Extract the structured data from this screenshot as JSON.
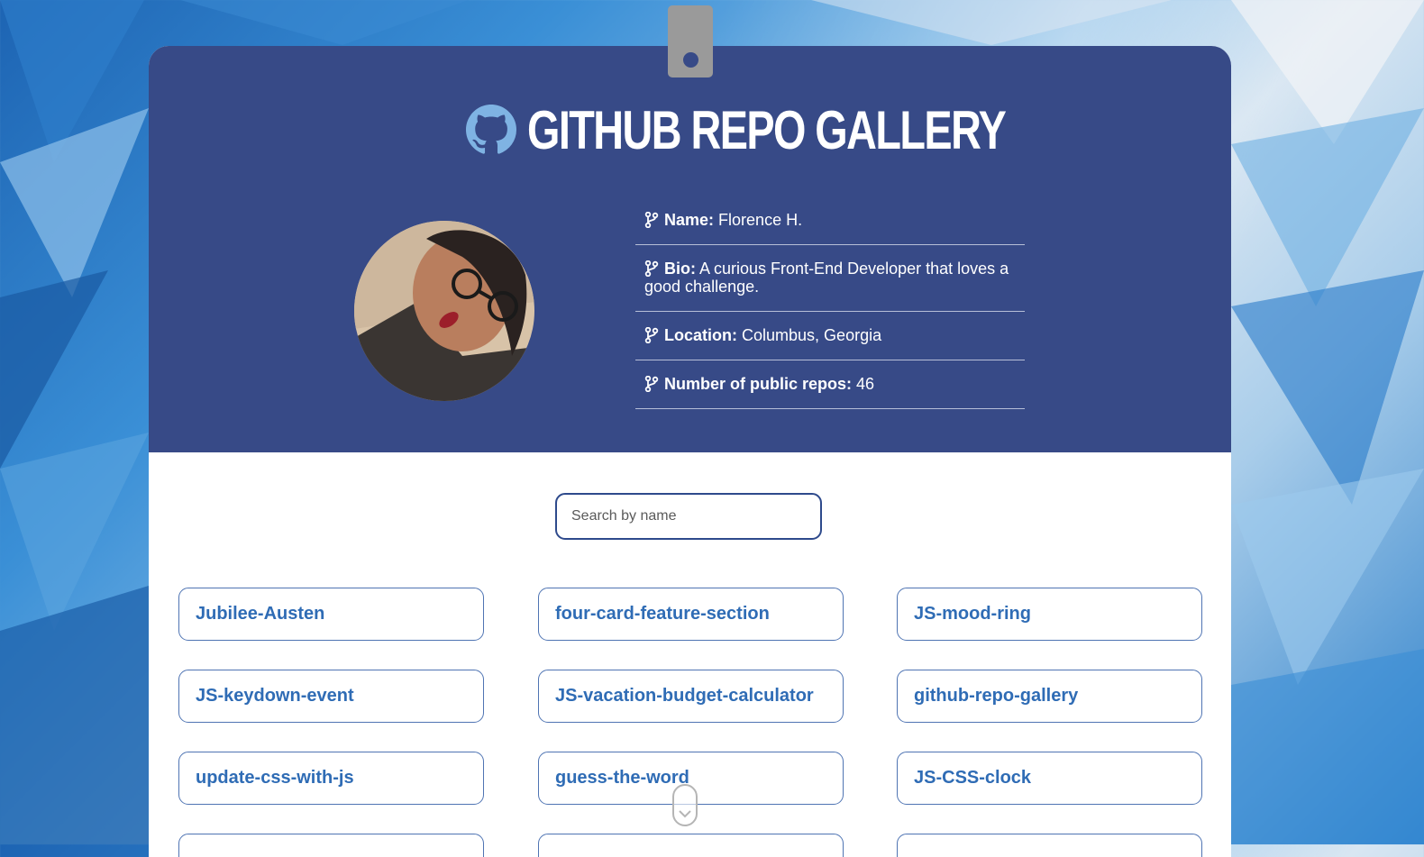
{
  "header": {
    "title": "GITHUB REPO GALLERY",
    "title_icon": "github-icon"
  },
  "profile": {
    "rows": [
      {
        "key": "Name:",
        "value": "Florence H."
      },
      {
        "key": "Bio:",
        "value": "A curious Front-End Developer that loves a good challenge."
      },
      {
        "key": "Location:",
        "value": "Columbus, Georgia"
      },
      {
        "key": "Number of public repos:",
        "value": "46"
      }
    ]
  },
  "search": {
    "placeholder": "Search by name",
    "value": ""
  },
  "repos": [
    "Jubilee-Austen",
    "four-card-feature-section",
    "JS-mood-ring",
    "JS-keydown-event",
    "JS-vacation-budget-calculator",
    "github-repo-gallery",
    "update-css-with-js",
    "guess-the-word",
    "JS-CSS-clock"
  ],
  "colors": {
    "hero": "#374a87",
    "repo_text": "#2f6cb5",
    "clip": "#9a9a9a"
  }
}
